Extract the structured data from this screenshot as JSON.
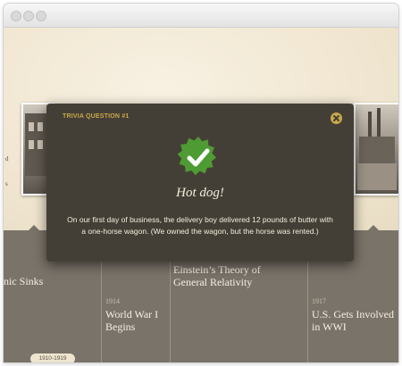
{
  "modal": {
    "label": "TRIVIA QUESTION #1",
    "answer": "Hot dog!",
    "explanation": "On our first day of business, the delivery boy delivered 12 pounds of butter with a one-horse wagon. (We owned the wagon, but the horse was rented.)",
    "close_icon": "close-icon",
    "badge_icon": "checkmark-badge-icon",
    "accent_color": "#c9a84a",
    "badge_color": "#4e9b33"
  },
  "left_edge": {
    "line1": "d",
    "line2": "s"
  },
  "timeline": {
    "events": [
      {
        "year": "",
        "title_lines": [
          "nic Sinks"
        ]
      },
      {
        "year": "1914",
        "title_lines": [
          "World War I",
          "Begins"
        ]
      },
      {
        "year": "",
        "title_lines": [
          "Einstein’s Theory of",
          "General Relativity"
        ]
      },
      {
        "year": "1917",
        "title_lines": [
          "U.S. Gets Involved",
          "in WWI"
        ]
      }
    ],
    "era_label": "1910-1919"
  }
}
